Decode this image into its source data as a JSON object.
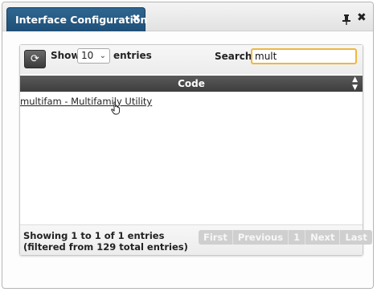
{
  "window": {
    "tab_title": "Interface Configuration",
    "tab_close_glyph": "✖",
    "close_glyph": "✖",
    "icons": [
      "pin-icon",
      "close-icon"
    ]
  },
  "toolbar": {
    "refresh_glyph": "⟳",
    "show_label": "Show",
    "page_length": "10",
    "entries_label": "entries",
    "search_label": "Search:",
    "search_value": "mult"
  },
  "table": {
    "columns": [
      "Code"
    ],
    "rows": [
      "multifam - Multifamily Utility"
    ]
  },
  "footer": {
    "info": "Showing 1 to 1 of 1 entries (filtered from 129 total entries)",
    "pager": {
      "first": "First",
      "previous": "Previous",
      "page": "1",
      "next": "Next",
      "last": "Last"
    }
  },
  "colors": {
    "tab_bg": "#2a5f88",
    "header_bg": "#4a4a4a",
    "search_border": "#f0b73f",
    "pager_bg": "#cfcfcf"
  }
}
